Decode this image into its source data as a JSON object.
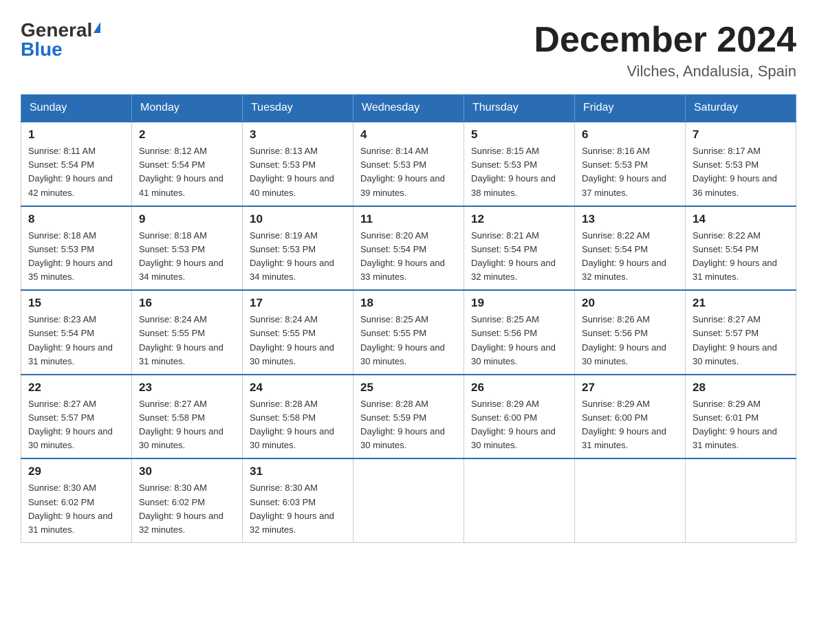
{
  "header": {
    "logo_general": "General",
    "logo_blue": "Blue",
    "month_title": "December 2024",
    "location": "Vilches, Andalusia, Spain"
  },
  "days_of_week": [
    "Sunday",
    "Monday",
    "Tuesday",
    "Wednesday",
    "Thursday",
    "Friday",
    "Saturday"
  ],
  "weeks": [
    [
      {
        "day": "1",
        "sunrise": "8:11 AM",
        "sunset": "5:54 PM",
        "daylight": "9 hours and 42 minutes."
      },
      {
        "day": "2",
        "sunrise": "8:12 AM",
        "sunset": "5:54 PM",
        "daylight": "9 hours and 41 minutes."
      },
      {
        "day": "3",
        "sunrise": "8:13 AM",
        "sunset": "5:53 PM",
        "daylight": "9 hours and 40 minutes."
      },
      {
        "day": "4",
        "sunrise": "8:14 AM",
        "sunset": "5:53 PM",
        "daylight": "9 hours and 39 minutes."
      },
      {
        "day": "5",
        "sunrise": "8:15 AM",
        "sunset": "5:53 PM",
        "daylight": "9 hours and 38 minutes."
      },
      {
        "day": "6",
        "sunrise": "8:16 AM",
        "sunset": "5:53 PM",
        "daylight": "9 hours and 37 minutes."
      },
      {
        "day": "7",
        "sunrise": "8:17 AM",
        "sunset": "5:53 PM",
        "daylight": "9 hours and 36 minutes."
      }
    ],
    [
      {
        "day": "8",
        "sunrise": "8:18 AM",
        "sunset": "5:53 PM",
        "daylight": "9 hours and 35 minutes."
      },
      {
        "day": "9",
        "sunrise": "8:18 AM",
        "sunset": "5:53 PM",
        "daylight": "9 hours and 34 minutes."
      },
      {
        "day": "10",
        "sunrise": "8:19 AM",
        "sunset": "5:53 PM",
        "daylight": "9 hours and 34 minutes."
      },
      {
        "day": "11",
        "sunrise": "8:20 AM",
        "sunset": "5:54 PM",
        "daylight": "9 hours and 33 minutes."
      },
      {
        "day": "12",
        "sunrise": "8:21 AM",
        "sunset": "5:54 PM",
        "daylight": "9 hours and 32 minutes."
      },
      {
        "day": "13",
        "sunrise": "8:22 AM",
        "sunset": "5:54 PM",
        "daylight": "9 hours and 32 minutes."
      },
      {
        "day": "14",
        "sunrise": "8:22 AM",
        "sunset": "5:54 PM",
        "daylight": "9 hours and 31 minutes."
      }
    ],
    [
      {
        "day": "15",
        "sunrise": "8:23 AM",
        "sunset": "5:54 PM",
        "daylight": "9 hours and 31 minutes."
      },
      {
        "day": "16",
        "sunrise": "8:24 AM",
        "sunset": "5:55 PM",
        "daylight": "9 hours and 31 minutes."
      },
      {
        "day": "17",
        "sunrise": "8:24 AM",
        "sunset": "5:55 PM",
        "daylight": "9 hours and 30 minutes."
      },
      {
        "day": "18",
        "sunrise": "8:25 AM",
        "sunset": "5:55 PM",
        "daylight": "9 hours and 30 minutes."
      },
      {
        "day": "19",
        "sunrise": "8:25 AM",
        "sunset": "5:56 PM",
        "daylight": "9 hours and 30 minutes."
      },
      {
        "day": "20",
        "sunrise": "8:26 AM",
        "sunset": "5:56 PM",
        "daylight": "9 hours and 30 minutes."
      },
      {
        "day": "21",
        "sunrise": "8:27 AM",
        "sunset": "5:57 PM",
        "daylight": "9 hours and 30 minutes."
      }
    ],
    [
      {
        "day": "22",
        "sunrise": "8:27 AM",
        "sunset": "5:57 PM",
        "daylight": "9 hours and 30 minutes."
      },
      {
        "day": "23",
        "sunrise": "8:27 AM",
        "sunset": "5:58 PM",
        "daylight": "9 hours and 30 minutes."
      },
      {
        "day": "24",
        "sunrise": "8:28 AM",
        "sunset": "5:58 PM",
        "daylight": "9 hours and 30 minutes."
      },
      {
        "day": "25",
        "sunrise": "8:28 AM",
        "sunset": "5:59 PM",
        "daylight": "9 hours and 30 minutes."
      },
      {
        "day": "26",
        "sunrise": "8:29 AM",
        "sunset": "6:00 PM",
        "daylight": "9 hours and 30 minutes."
      },
      {
        "day": "27",
        "sunrise": "8:29 AM",
        "sunset": "6:00 PM",
        "daylight": "9 hours and 31 minutes."
      },
      {
        "day": "28",
        "sunrise": "8:29 AM",
        "sunset": "6:01 PM",
        "daylight": "9 hours and 31 minutes."
      }
    ],
    [
      {
        "day": "29",
        "sunrise": "8:30 AM",
        "sunset": "6:02 PM",
        "daylight": "9 hours and 31 minutes."
      },
      {
        "day": "30",
        "sunrise": "8:30 AM",
        "sunset": "6:02 PM",
        "daylight": "9 hours and 32 minutes."
      },
      {
        "day": "31",
        "sunrise": "8:30 AM",
        "sunset": "6:03 PM",
        "daylight": "9 hours and 32 minutes."
      },
      null,
      null,
      null,
      null
    ]
  ]
}
